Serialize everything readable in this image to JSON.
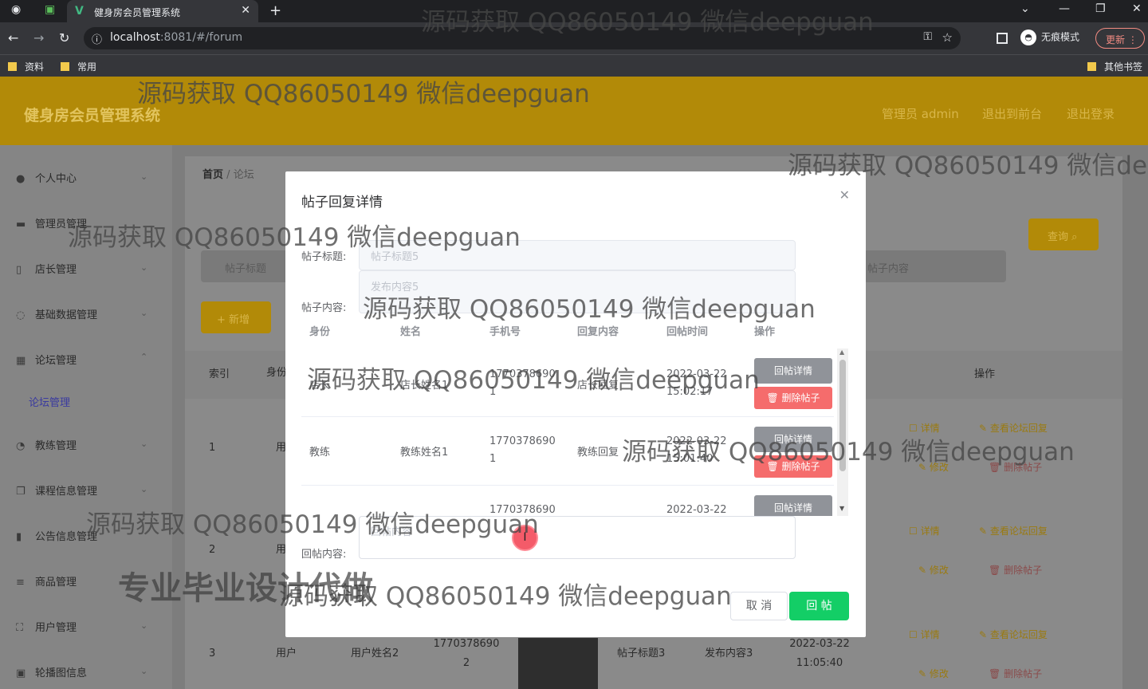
{
  "browser": {
    "tab_title": "健身房会员管理系统",
    "url_host": "localhost",
    "url_rest": ":8081/#/forum",
    "incognito_label": "无痕模式",
    "update_label": "更新",
    "bookmarks": [
      "资料",
      "常用"
    ],
    "other_bookmarks": "其他书签"
  },
  "app": {
    "title": "健身房会员管理系统",
    "admin_label": "管理员 admin",
    "back_label": "退出到前台",
    "logout_label": "退出登录"
  },
  "sidebar": {
    "items": [
      "个人中心",
      "管理员管理",
      "店长管理",
      "基础数据管理",
      "论坛管理",
      "教练管理",
      "课程信息管理",
      "公告信息管理",
      "商品管理",
      "用户管理",
      "轮播图信息"
    ],
    "sub_item": "论坛管理"
  },
  "breadcrumb": {
    "home": "首页",
    "sep": "/",
    "current": "论坛"
  },
  "toolbar": {
    "search_label": "查询 ⌕",
    "add_label": "+ 新增",
    "title_placeholder": "帖子标题",
    "content_placeholder": "帖子内容"
  },
  "table": {
    "headers": [
      "索引",
      "身份",
      "操作"
    ],
    "rows": [
      {
        "index": "1",
        "role": "用"
      },
      {
        "index": "2",
        "role": "用"
      },
      {
        "index": "3",
        "role": "用户",
        "name": "用户姓名2",
        "phone": "17703786902",
        "title": "帖子标题3",
        "content": "发布内容3",
        "time": "2022-03-22 11:05:40"
      }
    ],
    "ops": {
      "detail": "详情",
      "view_reply": "查看论坛回复",
      "edit": "修改",
      "delete": "删除帖子"
    }
  },
  "modal": {
    "title": "帖子回复详情",
    "post_title_label": "帖子标题:",
    "post_title_value": "帖子标题5",
    "post_content_label": "帖子内容:",
    "post_content_value": "发布内容5",
    "columns": [
      "身份",
      "姓名",
      "手机号",
      "回复内容",
      "回帖时间",
      "操作"
    ],
    "replies": [
      {
        "role": "店长",
        "name": "店长姓名1",
        "phone": "17703786901",
        "content": "店长回复",
        "time": "2022-03-22 15:02:17"
      },
      {
        "role": "教练",
        "name": "教练姓名1",
        "phone": "17703786901",
        "content": "教练回复",
        "time": "2022-03-22 15:01:40"
      },
      {
        "role": "",
        "name": "",
        "phone": "1770378690",
        "content": "",
        "time": "2022-03-22"
      }
    ],
    "detail_label": "回帖详情",
    "delete_label": "删除帖子",
    "reply_label": "回帖内容:",
    "reply_placeholder": "回帖内容",
    "cancel_label": "取 消",
    "submit_label": "回 帖"
  },
  "watermark": {
    "text": "源码获取 QQ86050149 微信deepguan",
    "big": "专业毕业设计代做"
  }
}
